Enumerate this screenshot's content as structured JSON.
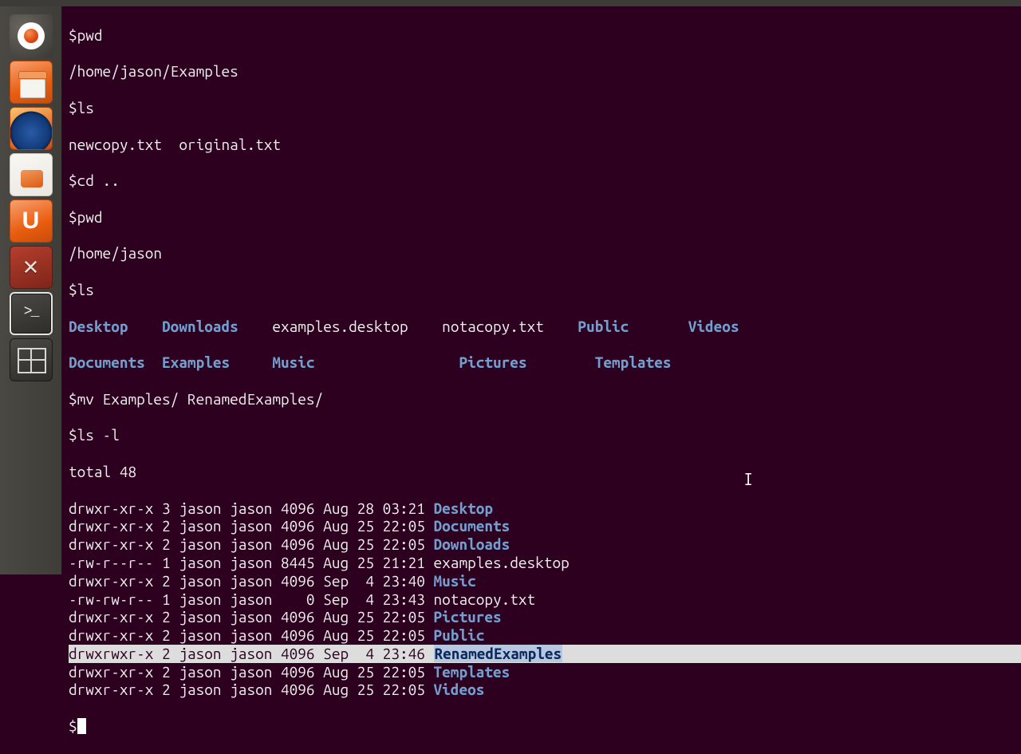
{
  "launcher": {
    "items": [
      {
        "name": "dash",
        "label": "Dash"
      },
      {
        "name": "files",
        "label": "Files"
      },
      {
        "name": "firefox",
        "label": "Firefox"
      },
      {
        "name": "software",
        "label": "Ubuntu Software Center"
      },
      {
        "name": "ubuntuone",
        "label": "U"
      },
      {
        "name": "settings",
        "label": "System Settings"
      },
      {
        "name": "terminal",
        "label": "Terminal"
      },
      {
        "name": "workspace",
        "label": "Workspace Switcher"
      }
    ]
  },
  "terminal": {
    "l1": "$pwd",
    "l2": "/home/jason/Examples",
    "l3": "$ls",
    "l4": "newcopy.txt  original.txt",
    "l5": "$cd ..",
    "l6": "$pwd",
    "l7": "/home/jason",
    "l8": "$ls",
    "ls_row1": {
      "c1": "Desktop",
      "c2": "Downloads",
      "c3": "examples.desktop",
      "c4": "notacopy.txt",
      "c5": "Public",
      "c6": "Videos"
    },
    "ls_row2": {
      "c1": "Documents",
      "c2": "Examples",
      "c3": "Music",
      "c4": "Pictures",
      "c5": "Templates"
    },
    "l11": "$mv Examples/ RenamedExamples/",
    "l12": "$ls -l",
    "l13": "total 48",
    "ll": [
      {
        "perm": "drwxr-xr-x",
        "n": "3",
        "u": "jason",
        "g": "jason",
        "sz": "4096",
        "dt": "Aug 28 03:21",
        "name": "Desktop",
        "dir": true
      },
      {
        "perm": "drwxr-xr-x",
        "n": "2",
        "u": "jason",
        "g": "jason",
        "sz": "4096",
        "dt": "Aug 25 22:05",
        "name": "Documents",
        "dir": true
      },
      {
        "perm": "drwxr-xr-x",
        "n": "2",
        "u": "jason",
        "g": "jason",
        "sz": "4096",
        "dt": "Aug 25 22:05",
        "name": "Downloads",
        "dir": true
      },
      {
        "perm": "-rw-r--r--",
        "n": "1",
        "u": "jason",
        "g": "jason",
        "sz": "8445",
        "dt": "Aug 25 21:21",
        "name": "examples.desktop",
        "dir": false
      },
      {
        "perm": "drwxr-xr-x",
        "n": "2",
        "u": "jason",
        "g": "jason",
        "sz": "4096",
        "dt": "Sep  4 23:40",
        "name": "Music",
        "dir": true
      },
      {
        "perm": "-rw-rw-r--",
        "n": "1",
        "u": "jason",
        "g": "jason",
        "sz": "   0",
        "dt": "Sep  4 23:43",
        "name": "notacopy.txt",
        "dir": false
      },
      {
        "perm": "drwxr-xr-x",
        "n": "2",
        "u": "jason",
        "g": "jason",
        "sz": "4096",
        "dt": "Aug 25 22:05",
        "name": "Pictures",
        "dir": true
      },
      {
        "perm": "drwxr-xr-x",
        "n": "2",
        "u": "jason",
        "g": "jason",
        "sz": "4096",
        "dt": "Aug 25 22:05",
        "name": "Public",
        "dir": true
      },
      {
        "perm": "drwxrwxr-x",
        "n": "2",
        "u": "jason",
        "g": "jason",
        "sz": "4096",
        "dt": "Sep  4 23:46",
        "name": "RenamedExamples",
        "dir": true,
        "hl": true
      },
      {
        "perm": "drwxr-xr-x",
        "n": "2",
        "u": "jason",
        "g": "jason",
        "sz": "4096",
        "dt": "Aug 25 22:05",
        "name": "Templates",
        "dir": true
      },
      {
        "perm": "drwxr-xr-x",
        "n": "2",
        "u": "jason",
        "g": "jason",
        "sz": "4096",
        "dt": "Aug 25 22:05",
        "name": "Videos",
        "dir": true
      }
    ],
    "prompt_final": "$"
  },
  "pad": {
    "ls1_c1": 9,
    "ls1_c2": 11,
    "ls1_c3": 18,
    "ls1_c4": 14,
    "ls1_c5": 11,
    "ls2_c1": 11,
    "ls2_c2": 11,
    "ls2_c3": 20,
    "ls2_c4": 14
  }
}
